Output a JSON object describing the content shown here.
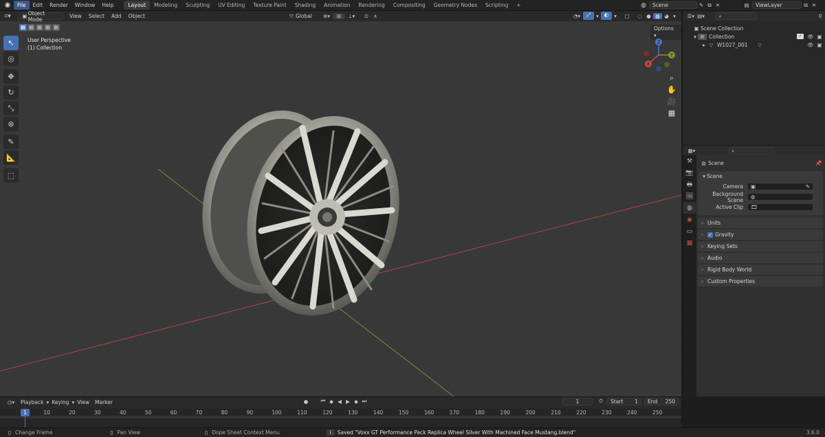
{
  "topbar": {
    "menus": [
      "File",
      "Edit",
      "Render",
      "Window",
      "Help"
    ],
    "workspaces": [
      "Layout",
      "Modeling",
      "Sculpting",
      "UV Editing",
      "Texture Paint",
      "Shading",
      "Animation",
      "Rendering",
      "Compositing",
      "Geometry Nodes",
      "Scripting"
    ],
    "add_tab": "+",
    "scene_name": "Scene",
    "view_layer": "ViewLayer"
  },
  "viewport": {
    "mode": "Object Mode",
    "menus": [
      "View",
      "Select",
      "Add",
      "Object"
    ],
    "orientation": "Global",
    "options_label": "Options",
    "overlay_line1": "User Perspective",
    "overlay_line2": "(1) Collection",
    "gizmo": {
      "x": "X",
      "y": "Y",
      "z": "Z"
    }
  },
  "outliner": {
    "scene_collection": "Scene Collection",
    "collection": "Collection",
    "object": "W1027_001"
  },
  "properties": {
    "context_title": "Scene",
    "section": "Scene",
    "fields": [
      {
        "label": "Camera"
      },
      {
        "label": "Background Scene"
      },
      {
        "label": "Active Clip"
      }
    ],
    "panels": [
      "Units",
      "Gravity",
      "Keying Sets",
      "Audio",
      "Rigid Body World",
      "Custom Properties"
    ]
  },
  "timeline": {
    "menus": [
      "Playback",
      "Keying",
      "View",
      "Marker"
    ],
    "current_frame": "1",
    "start_label": "Start",
    "start_value": "1",
    "end_label": "End",
    "end_value": "250",
    "ticks": [
      "1",
      "10",
      "20",
      "30",
      "40",
      "50",
      "60",
      "70",
      "80",
      "90",
      "100",
      "110",
      "120",
      "130",
      "140",
      "150",
      "160",
      "170",
      "180",
      "190",
      "200",
      "210",
      "220",
      "230",
      "240",
      "250"
    ],
    "playhead": "1"
  },
  "statusbar": {
    "left1": "Change Frame",
    "left2": "Pan View",
    "left3": "Dope Sheet Context Menu",
    "message": "Saved \"Voxx GT Performance Pack Replica Wheel Silver With Machined Face Mustang.blend\"",
    "version": "3.6.0"
  },
  "colors": {
    "accent": "#4772b3",
    "x_axis": "#c84a4a",
    "y_axis": "#7d9a2c",
    "z_axis": "#4a7bc4"
  }
}
